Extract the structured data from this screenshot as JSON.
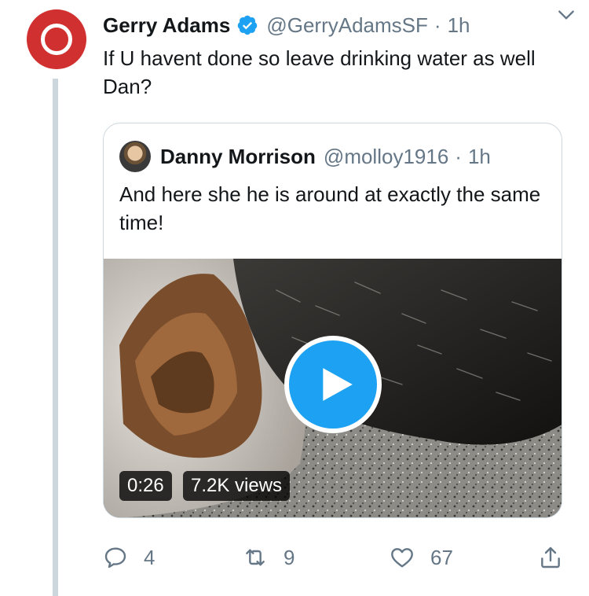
{
  "tweet": {
    "author_name": "Gerry Adams",
    "handle": "@GerryAdamsSF",
    "separator": "·",
    "time": "1h",
    "text": "If U havent done so leave  drinking water as well Dan?",
    "verified": true
  },
  "quoted_tweet": {
    "author_name": "Danny Morrison",
    "handle": "@molloy1916",
    "separator": "·",
    "time": "1h",
    "text": "And here she he is around at exactly the same time!",
    "media": {
      "type": "video",
      "duration": "0:26",
      "views": "7.2K views"
    }
  },
  "actions": {
    "reply_count": "4",
    "retweet_count": "9",
    "like_count": "67"
  },
  "icons": {
    "verified": "verified-badge-icon",
    "more": "chevron-down-icon",
    "play": "play-icon",
    "reply": "reply-icon",
    "retweet": "retweet-icon",
    "like": "heart-icon",
    "share": "share-icon"
  },
  "colors": {
    "accent": "#1da1f2",
    "avatar_red": "#d0302f",
    "secondary_text": "#657786",
    "border": "#ccd6dd"
  }
}
